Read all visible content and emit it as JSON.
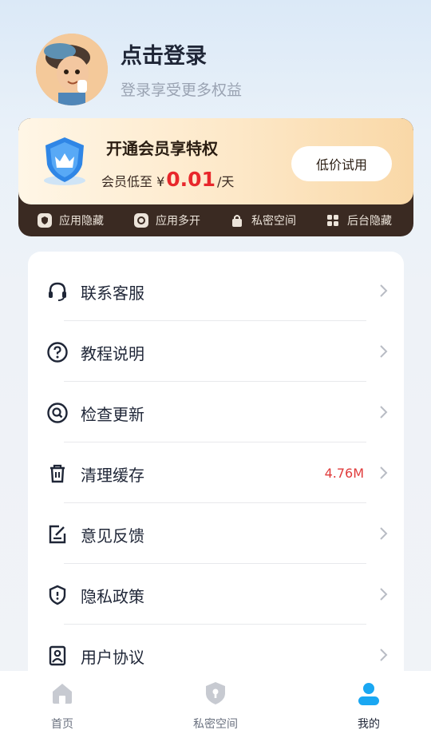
{
  "profile": {
    "title": "点击登录",
    "subtitle": "登录享受更多权益"
  },
  "vip": {
    "title": "开通会员享特权",
    "price_prefix": "会员低至 ¥",
    "price": "0.01",
    "price_suffix": "/天",
    "trial_button": "低价试用",
    "features": [
      {
        "label": "应用隐藏",
        "icon": "shield-icon"
      },
      {
        "label": "应用多开",
        "icon": "copy-icon"
      },
      {
        "label": "私密空间",
        "icon": "lock-icon"
      },
      {
        "label": "后台隐藏",
        "icon": "grid-icon"
      }
    ],
    "colors": {
      "accent": "#e8272b",
      "dark": "#3a2a22",
      "gold": "#f9d8a7"
    }
  },
  "menu": {
    "items": [
      {
        "label": "联系客服",
        "icon": "headset-icon"
      },
      {
        "label": "教程说明",
        "icon": "question-icon"
      },
      {
        "label": "检查更新",
        "icon": "search-update-icon"
      },
      {
        "label": "清理缓存",
        "icon": "trash-icon",
        "value": "4.76M"
      },
      {
        "label": "意见反馈",
        "icon": "feedback-icon"
      },
      {
        "label": "隐私政策",
        "icon": "shield-info-icon"
      },
      {
        "label": "用户协议",
        "icon": "user-agreement-icon"
      }
    ]
  },
  "tabbar": {
    "tabs": [
      {
        "label": "首页",
        "icon": "home-icon"
      },
      {
        "label": "私密空间",
        "icon": "private-shield-icon"
      },
      {
        "label": "我的",
        "icon": "user-icon",
        "active": true
      }
    ],
    "active_color": "#1aa7f2"
  }
}
